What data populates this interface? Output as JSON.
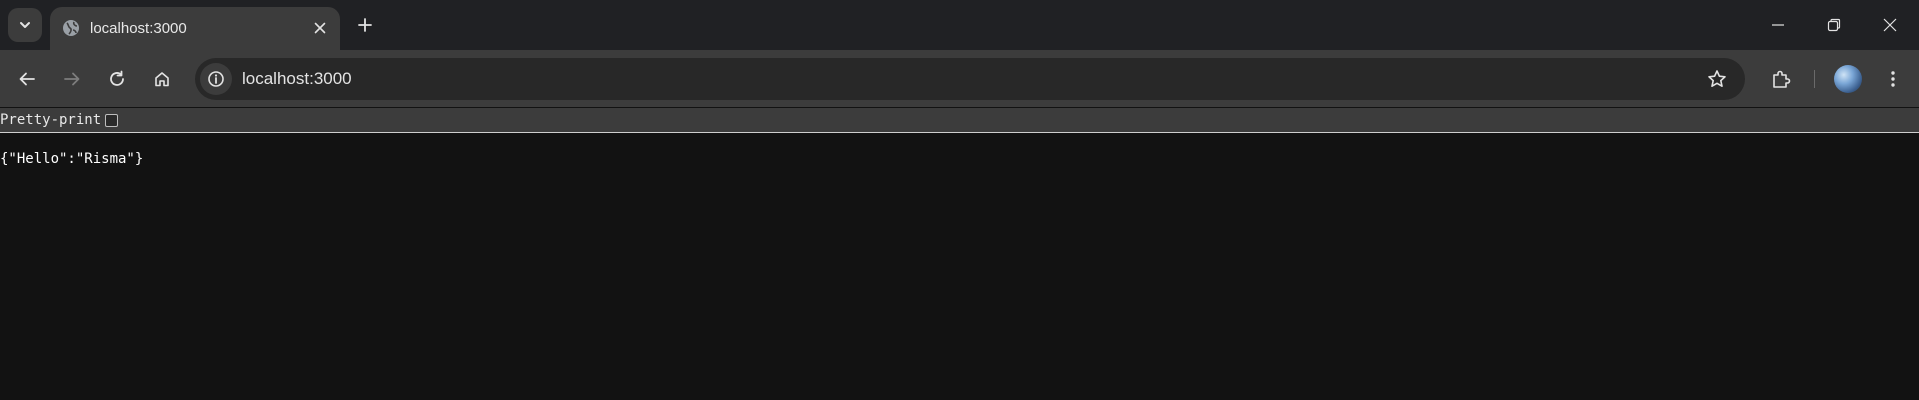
{
  "tab": {
    "title": "localhost:3000",
    "favicon": "globe-icon"
  },
  "window_controls": [
    "minimize-icon",
    "restore-icon",
    "close-icon"
  ],
  "toolbar": {
    "url": "localhost:3000",
    "icons": [
      "back-arrow-icon",
      "forward-arrow-icon",
      "reload-icon",
      "home-icon",
      "info-icon",
      "star-icon",
      "extensions-icon",
      "avatar",
      "kebab-menu-icon"
    ]
  },
  "page": {
    "pretty_print_label": "Pretty-print",
    "pretty_print_checked": false,
    "json_text": "{\"Hello\":\"Risma\"}"
  },
  "colors": {
    "tabstrip": "#202124",
    "toolbar": "#3c3c3c",
    "omnibox": "#282828",
    "page_background": "#121212"
  }
}
